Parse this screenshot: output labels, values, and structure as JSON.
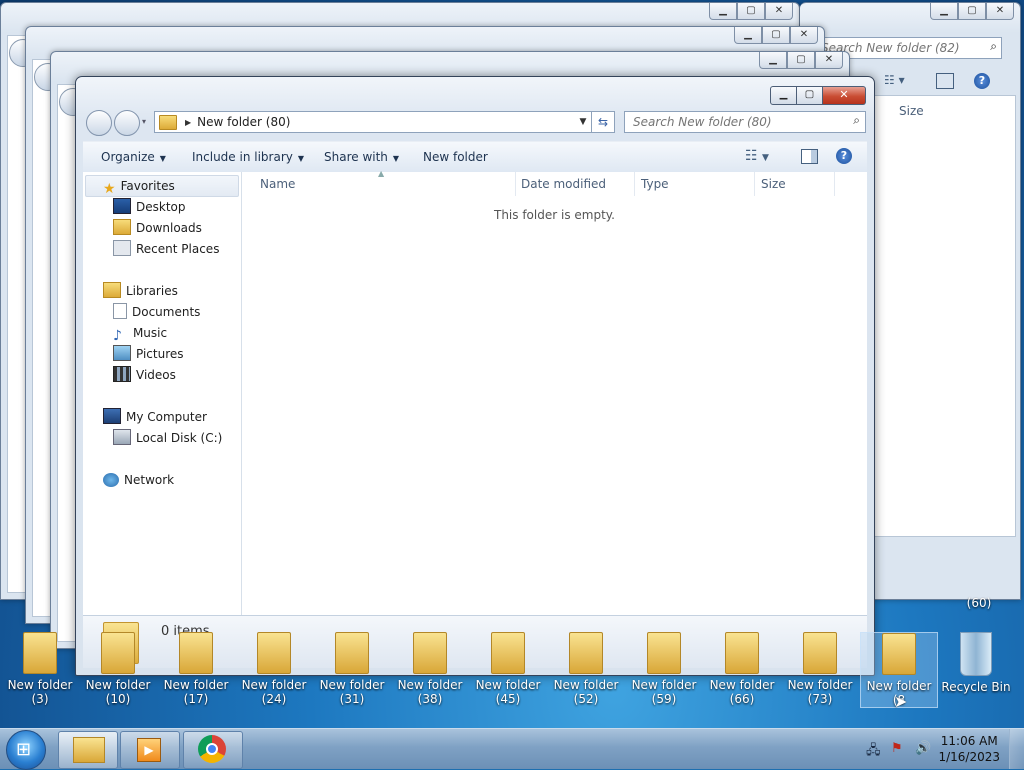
{
  "window": {
    "address_path": "New folder (80)",
    "search_placeholder": "Search New folder (80)"
  },
  "background_window": {
    "search_placeholder": "Search New folder (82)",
    "size_header": "Size"
  },
  "toolbar": {
    "organize": "Organize",
    "include_in_library": "Include in library",
    "share_with": "Share with",
    "new_folder": "New folder",
    "help": "?"
  },
  "navigation": {
    "favorites": "Favorites",
    "desktop": "Desktop",
    "downloads": "Downloads",
    "recent_places": "Recent Places",
    "libraries": "Libraries",
    "documents": "Documents",
    "music": "Music",
    "pictures": "Pictures",
    "videos": "Videos",
    "my_computer": "My Computer",
    "local_disk": "Local Disk (C:)",
    "network": "Network"
  },
  "columns": {
    "name": "Name",
    "date_modified": "Date modified",
    "type": "Type",
    "size": "Size"
  },
  "content": {
    "empty_message": "This folder is empty."
  },
  "details": {
    "item_count": "0 items"
  },
  "desktop_icons": [
    {
      "line1": "New folder",
      "line2": "(3)"
    },
    {
      "line1": "New folder",
      "line2": "(10)"
    },
    {
      "line1": "New folder",
      "line2": "(17)"
    },
    {
      "line1": "New folder",
      "line2": "(24)"
    },
    {
      "line1": "New folder",
      "line2": "(31)"
    },
    {
      "line1": "New folder",
      "line2": "(38)"
    },
    {
      "line1": "New folder",
      "line2": "(45)"
    },
    {
      "line1": "New folder",
      "line2": "(52)"
    },
    {
      "line1": "New folder",
      "line2": "(59)"
    },
    {
      "line1": "New folder",
      "line2": "(66)"
    },
    {
      "line1": "New folder",
      "line2": "(73)"
    },
    {
      "line1": "New folder",
      "line2": "(8"
    }
  ],
  "recycle_bin": {
    "label": "Recycle Bin",
    "above_label": "(60)"
  },
  "clock": {
    "time": "11:06 AM",
    "date": "1/16/2023"
  },
  "icons": {
    "favorites": "star-icon",
    "desktop": "monitor-icon",
    "network": "network-icon"
  },
  "colors": {
    "accent": "#1d78c0",
    "close_button": "#c94d33"
  }
}
